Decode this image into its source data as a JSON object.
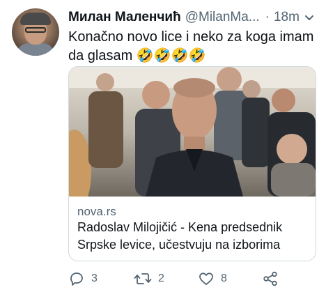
{
  "tweet": {
    "author_name": "Милан Маленчић",
    "handle": "@MilanMa...",
    "separator": "·",
    "time": "18m",
    "text": "Konačno novo lice i neko za koga imam da glasam",
    "emojis": "🤣🤣🤣🤣"
  },
  "card": {
    "domain": "nova.rs",
    "title": "Radoslav Milojičić - Kena predsednik Srpske levice, učestvuju na izborima"
  },
  "actions": {
    "reply_count": "3",
    "retweet_count": "2",
    "like_count": "8"
  },
  "colors": {
    "text": "#0f1419",
    "muted": "#536471",
    "border": "#cfd9de"
  }
}
